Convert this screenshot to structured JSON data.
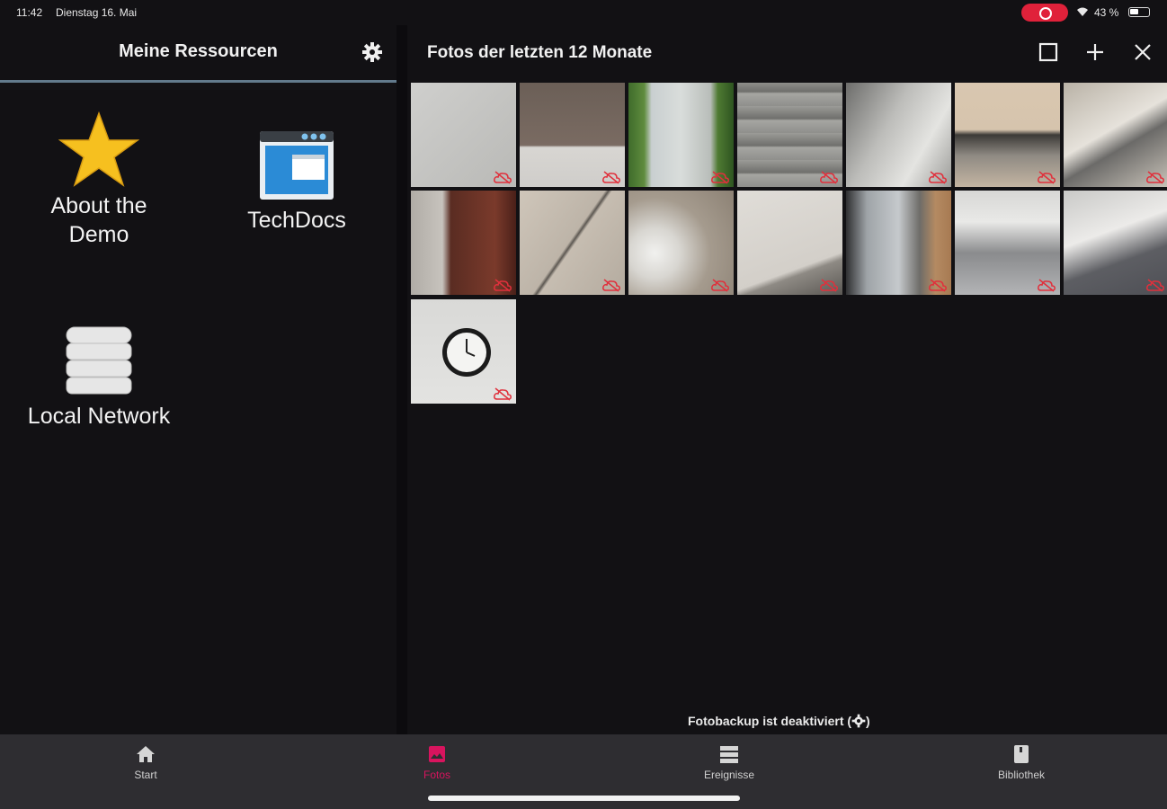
{
  "status_bar": {
    "time": "11:42",
    "date": "Dienstag 16. Mai",
    "battery": "43 %",
    "recording_color": "#e0213a"
  },
  "left_panel": {
    "title": "Meine Ressourcen",
    "settings_icon": "gear-icon",
    "resources": [
      {
        "label_line1": "About the",
        "label_line2": "Demo",
        "icon": "star-icon"
      },
      {
        "label_line1": "TechDocs",
        "label_line2": "",
        "icon": "browser-window-icon"
      },
      {
        "label_line1": "Local Network",
        "label_line2": "",
        "icon": "database-icon"
      }
    ]
  },
  "right_panel": {
    "title": "Fotos der letzten 12 Monate",
    "actions": [
      "select-square-icon",
      "plus-icon",
      "close-icon"
    ],
    "photo_count": 15,
    "cloud_status_icon": "cloud-off-icon",
    "cloud_status_color": "#e0303c",
    "backup_note": "Fotobackup ist deaktiviert ("
  },
  "tabbar": {
    "tabs": [
      {
        "label": "Start",
        "icon": "home-icon",
        "active": false
      },
      {
        "label": "Fotos",
        "icon": "photo-icon",
        "active": true
      },
      {
        "label": "Ereignisse",
        "icon": "list-icon",
        "active": false
      },
      {
        "label": "Bibliothek",
        "icon": "book-icon",
        "active": false
      }
    ],
    "accent_color": "#d8145e"
  }
}
